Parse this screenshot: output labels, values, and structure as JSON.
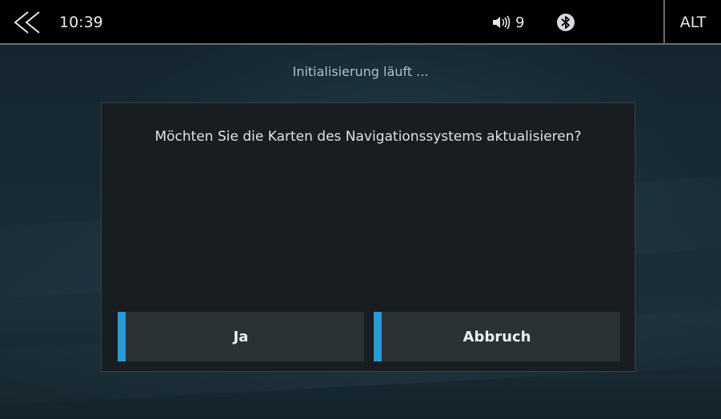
{
  "status_bar": {
    "time": "10:39",
    "volume_level": "9",
    "alt_label": "ALT",
    "icons": {
      "back": "double-chevron-left-icon",
      "volume": "speaker-icon",
      "bluetooth": "bluetooth-icon"
    }
  },
  "screen": {
    "subtitle": "Initialisierung läuft ..."
  },
  "dialog": {
    "message": "Möchten Sie die Karten des Navigationssystems aktualisieren?",
    "confirm_label": "Ja",
    "cancel_label": "Abbruch",
    "accent_color": "#2a9bd6"
  }
}
